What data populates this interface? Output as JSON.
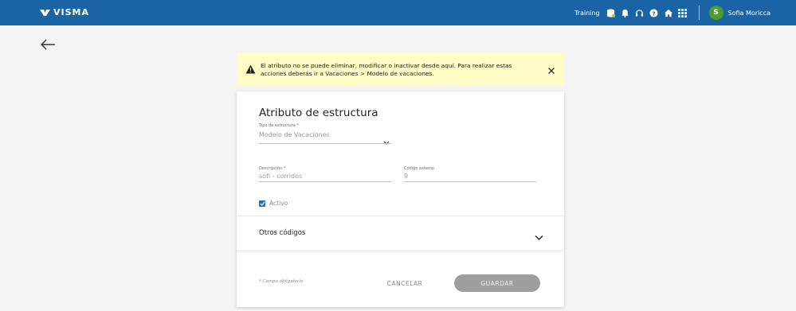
{
  "header": {
    "logo_text": "VISMA",
    "training_label": "Training",
    "icons": [
      "database-icon",
      "bell-icon",
      "headset-icon",
      "help-icon",
      "home-icon",
      "apps-grid-icon"
    ],
    "user": {
      "initial": "S",
      "name": "Sofia Moricca",
      "avatar_color": "#4e9c2d"
    },
    "bar_color": "#1a63a5"
  },
  "alert": {
    "message": "El atributo no se puede eliminar, modificar o inactivar desde aquí. Para realizar estas acciones deberás ir a Vacaciones > Modelo de vacaciones.",
    "background": "#fefdc5"
  },
  "form": {
    "title": "Atributo de estructura",
    "tipo": {
      "label": "Tipo de estructura *",
      "value": "Modelo de Vacaciones"
    },
    "descripcion": {
      "label": "Descripción *",
      "value": "sofi - corridos"
    },
    "codigo_externo": {
      "label": "Código externo",
      "value": "9"
    },
    "activo": {
      "label": "Activo",
      "checked": true
    },
    "otros_codigos": "Otros códigos",
    "required_note": "* Campo obligatorio",
    "cancel_label": "CANCELAR",
    "save_label": "GUARDAR"
  }
}
